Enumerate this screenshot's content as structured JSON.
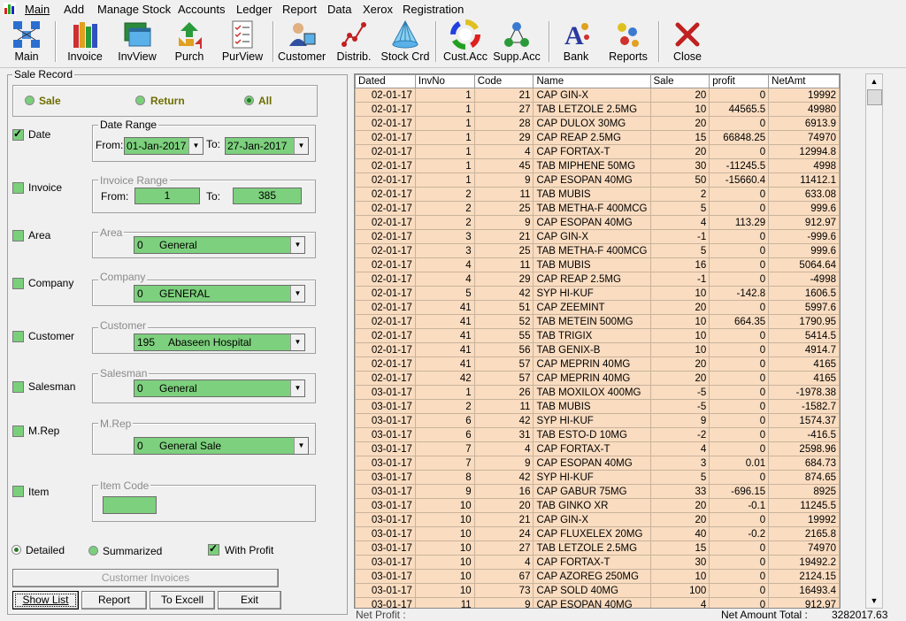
{
  "menu": [
    "Main",
    "Add",
    "Manage Stock",
    "Accounts",
    "Ledger",
    "Report",
    "Data",
    "Xerox",
    "Registration"
  ],
  "toolbar": [
    {
      "label": "Main",
      "icon": "network-icon"
    },
    {
      "label": "Invoice",
      "icon": "books-icon"
    },
    {
      "label": "InvView",
      "icon": "window-icon"
    },
    {
      "label": "Purch",
      "icon": "recycle-icon"
    },
    {
      "label": "PurView",
      "icon": "checklist-icon"
    },
    {
      "label": "Customer",
      "icon": "customer-icon"
    },
    {
      "label": "Distrib.",
      "icon": "distrib-icon"
    },
    {
      "label": "Stock Crd",
      "icon": "pyramid-icon"
    },
    {
      "label": "Cust.Acc",
      "icon": "colorwheel-icon"
    },
    {
      "label": "Supp.Acc",
      "icon": "molecule-icon"
    },
    {
      "label": "Bank",
      "icon": "font-icon"
    },
    {
      "label": "Reports",
      "icon": "dots-icon"
    },
    {
      "label": "Close",
      "icon": "close-icon"
    }
  ],
  "form": {
    "sale_record": "Sale Record",
    "type": {
      "sale": "Sale",
      "return": "Return",
      "all": "All"
    },
    "date": {
      "label": "Date",
      "range_title": "Date Range",
      "from_label": "From:",
      "from_value": "01-Jan-2017",
      "to_label": "To:",
      "to_value": "27-Jan-2017"
    },
    "invoice": {
      "label": "Invoice",
      "range_title": "Invoice Range",
      "from_label": "From:",
      "from_value": "1",
      "to_label": "To:",
      "to_value": "385"
    },
    "area": {
      "label": "Area",
      "title": "Area",
      "code": "0",
      "value": "General"
    },
    "company": {
      "label": "Company",
      "title": "Company",
      "code": "0",
      "value": "GENERAL"
    },
    "customer": {
      "label": "Customer",
      "title": "Customer",
      "code": "195",
      "value": "Abaseen Hospital"
    },
    "salesman": {
      "label": "Salesman",
      "title": "Salesman",
      "code": "0",
      "value": "General"
    },
    "mrep": {
      "label": "M.Rep",
      "title": "M.Rep",
      "code": "0",
      "value": "General Sale"
    },
    "item": {
      "label": "Item",
      "title": "Item Code"
    },
    "detailed": "Detailed",
    "summarized": "Summarized",
    "with_profit": "With Profit",
    "customer_invoices": "Customer Invoices",
    "buttons": {
      "show_list": "Show List",
      "report": "Report",
      "to_excel": "To Excell",
      "exit": "Exit"
    }
  },
  "table": {
    "columns": [
      "Dated",
      "InvNo",
      "Code",
      "Name",
      "Sale",
      "profit",
      "NetAmt"
    ],
    "rows": [
      [
        "02-01-17",
        "1",
        "21",
        "CAP GIN-X",
        "20",
        "0",
        "19992"
      ],
      [
        "02-01-17",
        "1",
        "27",
        "TAB LETZOLE 2.5MG",
        "10",
        "44565.5",
        "49980"
      ],
      [
        "02-01-17",
        "1",
        "28",
        "CAP DULOX 30MG",
        "20",
        "0",
        "6913.9"
      ],
      [
        "02-01-17",
        "1",
        "29",
        "CAP REAP 2.5MG",
        "15",
        "66848.25",
        "74970"
      ],
      [
        "02-01-17",
        "1",
        "4",
        "CAP FORTAX-T",
        "20",
        "0",
        "12994.8"
      ],
      [
        "02-01-17",
        "1",
        "45",
        "TAB MIPHENE 50MG",
        "30",
        "-11245.5",
        "4998"
      ],
      [
        "02-01-17",
        "1",
        "9",
        "CAP ESOPAN 40MG",
        "50",
        "-15660.4",
        "11412.1"
      ],
      [
        "02-01-17",
        "2",
        "11",
        "TAB MUBIS",
        "2",
        "0",
        "633.08"
      ],
      [
        "02-01-17",
        "2",
        "25",
        "TAB METHA-F 400MCG",
        "5",
        "0",
        "999.6"
      ],
      [
        "02-01-17",
        "2",
        "9",
        "CAP ESOPAN 40MG",
        "4",
        "113.29",
        "912.97"
      ],
      [
        "02-01-17",
        "3",
        "21",
        "CAP GIN-X",
        "-1",
        "0",
        "-999.6"
      ],
      [
        "02-01-17",
        "3",
        "25",
        "TAB METHA-F 400MCG",
        "5",
        "0",
        "999.6"
      ],
      [
        "02-01-17",
        "4",
        "11",
        "TAB MUBIS",
        "16",
        "0",
        "5064.64"
      ],
      [
        "02-01-17",
        "4",
        "29",
        "CAP REAP 2.5MG",
        "-1",
        "0",
        "-4998"
      ],
      [
        "02-01-17",
        "5",
        "42",
        "SYP HI-KUF",
        "10",
        "-142.8",
        "1606.5"
      ],
      [
        "02-01-17",
        "41",
        "51",
        "CAP ZEEMINT",
        "20",
        "0",
        "5997.6"
      ],
      [
        "02-01-17",
        "41",
        "52",
        "TAB METEIN 500MG",
        "10",
        "664.35",
        "1790.95"
      ],
      [
        "02-01-17",
        "41",
        "55",
        "TAB TRIGIX",
        "10",
        "0",
        "5414.5"
      ],
      [
        "02-01-17",
        "41",
        "56",
        "TAB GENIX-B",
        "10",
        "0",
        "4914.7"
      ],
      [
        "02-01-17",
        "41",
        "57",
        "CAP MEPRIN 40MG",
        "20",
        "0",
        "4165"
      ],
      [
        "02-01-17",
        "42",
        "57",
        "CAP MEPRIN 40MG",
        "20",
        "0",
        "4165"
      ],
      [
        "03-01-17",
        "1",
        "26",
        "TAB MOXILOX 400MG",
        "-5",
        "0",
        "-1978.38"
      ],
      [
        "03-01-17",
        "2",
        "11",
        "TAB MUBIS",
        "-5",
        "0",
        "-1582.7"
      ],
      [
        "03-01-17",
        "6",
        "42",
        "SYP HI-KUF",
        "9",
        "0",
        "1574.37"
      ],
      [
        "03-01-17",
        "6",
        "31",
        "TAB ESTO-D 10MG",
        "-2",
        "0",
        "-416.5"
      ],
      [
        "03-01-17",
        "7",
        "4",
        "CAP FORTAX-T",
        "4",
        "0",
        "2598.96"
      ],
      [
        "03-01-17",
        "7",
        "9",
        "CAP ESOPAN 40MG",
        "3",
        "0.01",
        "684.73"
      ],
      [
        "03-01-17",
        "8",
        "42",
        "SYP HI-KUF",
        "5",
        "0",
        "874.65"
      ],
      [
        "03-01-17",
        "9",
        "16",
        "CAP GABUR 75MG",
        "33",
        "-696.15",
        "8925"
      ],
      [
        "03-01-17",
        "10",
        "20",
        "TAB GINKO XR",
        "20",
        "-0.1",
        "11245.5"
      ],
      [
        "03-01-17",
        "10",
        "21",
        "CAP GIN-X",
        "20",
        "0",
        "19992"
      ],
      [
        "03-01-17",
        "10",
        "24",
        "CAP FLUXELEX 20MG",
        "40",
        "-0.2",
        "2165.8"
      ],
      [
        "03-01-17",
        "10",
        "27",
        "TAB LETZOLE 2.5MG",
        "15",
        "0",
        "74970"
      ],
      [
        "03-01-17",
        "10",
        "4",
        "CAP FORTAX-T",
        "30",
        "0",
        "19492.2"
      ],
      [
        "03-01-17",
        "10",
        "67",
        "CAP AZOREG 250MG",
        "10",
        "0",
        "2124.15"
      ],
      [
        "03-01-17",
        "10",
        "73",
        "CAP SOLD 40MG",
        "100",
        "0",
        "16493.4"
      ],
      [
        "03-01-17",
        "11",
        "9",
        "CAP ESOPAN 40MG",
        "4",
        "0",
        "912.97"
      ]
    ]
  },
  "footer": {
    "net_profit_label": "Net Profit :",
    "net_profit_value": "",
    "net_amount_label": "Net Amount Total :",
    "net_amount_value": "3282017.63"
  }
}
